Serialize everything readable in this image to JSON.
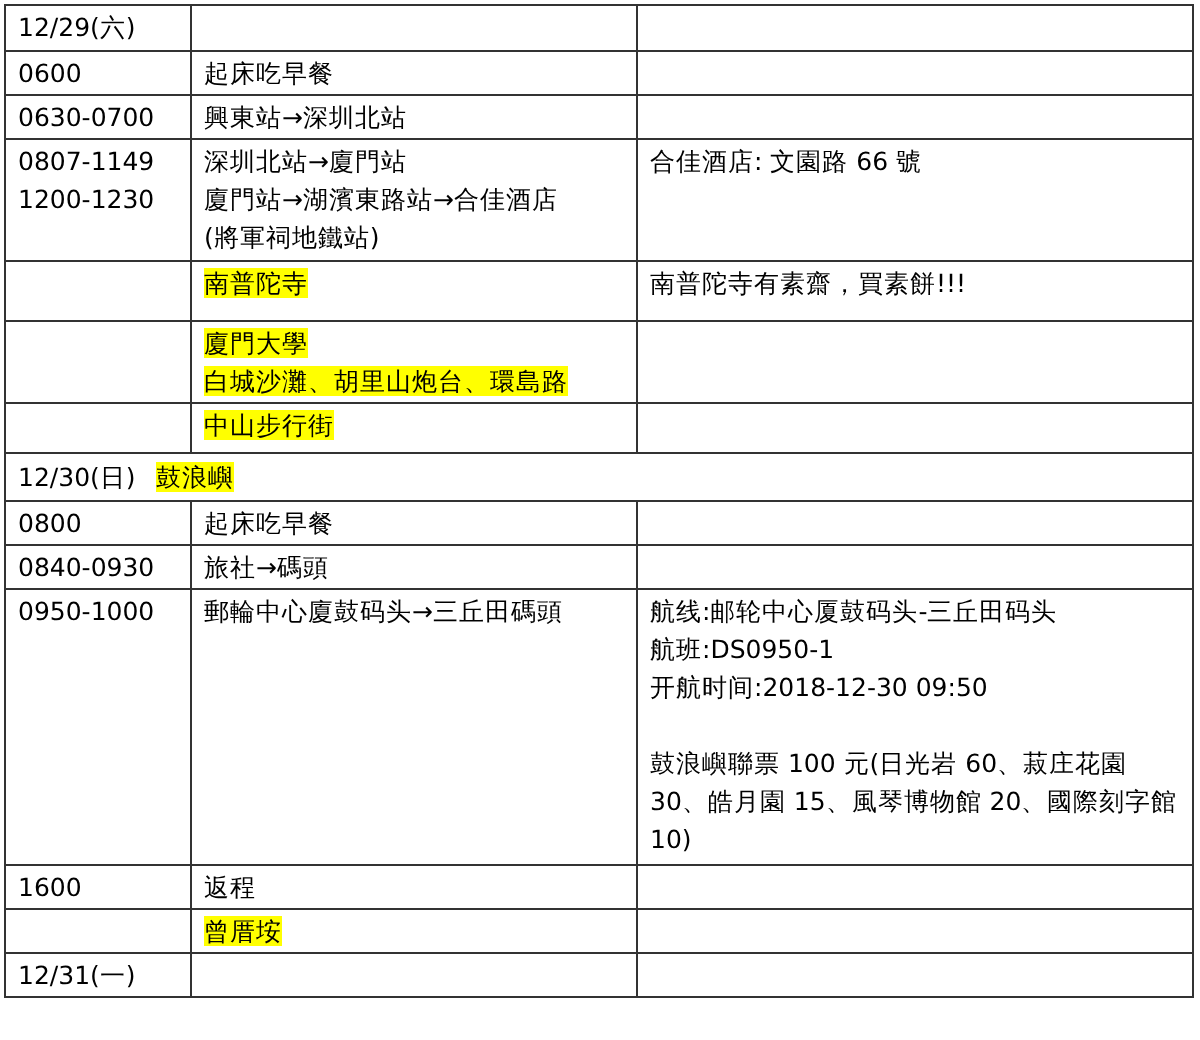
{
  "rows": [
    {
      "kind": "item",
      "time": [
        "12/29(六)"
      ],
      "activity": [],
      "notes": []
    },
    {
      "kind": "item",
      "time": [
        "0600"
      ],
      "activity": [
        {
          "text": "起床吃早餐",
          "highlight": false
        }
      ],
      "notes": []
    },
    {
      "kind": "item",
      "time": [
        "0630-0700"
      ],
      "activity": [
        {
          "text": "興東站→深圳北站",
          "highlight": false
        }
      ],
      "notes": []
    },
    {
      "kind": "item",
      "time": [
        "0807-1149",
        "1200-1230"
      ],
      "activity": [
        {
          "text": "深圳北站→廈門站",
          "highlight": false
        },
        {
          "text": "廈門站→湖濱東路站→合佳酒店",
          "highlight": false
        },
        {
          "text": "(將軍祠地鐵站)",
          "highlight": false
        }
      ],
      "notes": [
        "合佳酒店: 文園路 66 號"
      ]
    },
    {
      "kind": "item",
      "time": [],
      "activity": [
        {
          "text": "南普陀寺",
          "highlight": true
        }
      ],
      "notes": [
        "南普陀寺有素齋，買素餅!!!"
      ]
    },
    {
      "kind": "item",
      "time": [],
      "activity": [
        {
          "text": "廈門大學",
          "highlight": true
        },
        {
          "text": "白城沙灘、胡里山炮台、環島路",
          "highlight": true
        }
      ],
      "notes": []
    },
    {
      "kind": "item",
      "time": [],
      "activity": [
        {
          "text": "中山步行街",
          "highlight": true
        }
      ],
      "notes": []
    },
    {
      "kind": "day",
      "date": "12/30(日)",
      "place": "鼓浪嶼"
    },
    {
      "kind": "item",
      "time": [
        "0800"
      ],
      "activity": [
        {
          "text": "起床吃早餐",
          "highlight": false
        }
      ],
      "notes": []
    },
    {
      "kind": "item",
      "time": [
        "0840-0930"
      ],
      "activity": [
        {
          "text": "旅社→碼頭",
          "highlight": false
        }
      ],
      "notes": []
    },
    {
      "kind": "item",
      "time": [
        "0950-1000"
      ],
      "activity": [
        {
          "text": "郵輪中心廈鼓码头→三丘田碼頭",
          "highlight": false
        }
      ],
      "notes": [
        "航线:邮轮中心厦鼓码头-三丘田码头",
        "航班:DS0950-1",
        "开航时间:2018-12-30 09:50",
        {
          "text": "鼓浪嶼聯票 100 元(日光岩 60、菽庄花園 30、皓月園 15、風琴博物館 20、國際刻字館 10)",
          "spaced": true
        }
      ]
    },
    {
      "kind": "item",
      "time": [
        "1600"
      ],
      "activity": [
        {
          "text": "返程",
          "highlight": false
        }
      ],
      "notes": []
    },
    {
      "kind": "item",
      "time": [],
      "activity": [
        {
          "text": "曾厝垵",
          "highlight": true
        }
      ],
      "notes": []
    },
    {
      "kind": "item",
      "time": [
        "12/31(一)"
      ],
      "activity": [],
      "notes": []
    }
  ]
}
